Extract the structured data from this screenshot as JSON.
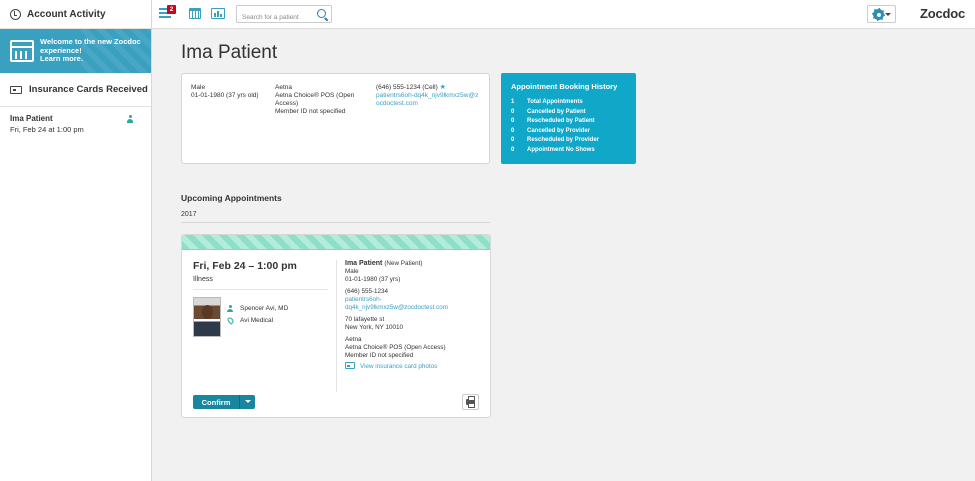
{
  "sidebar": {
    "header_title": "Account Activity",
    "welcome": {
      "line1": "Welcome to the new Zocdoc",
      "line2": "experience!",
      "line3": "Learn more."
    },
    "section_title": "Insurance Cards Received",
    "items": [
      {
        "name": "Ima Patient",
        "time": "Fri, Feb 24 at 1:00 pm"
      }
    ]
  },
  "topbar": {
    "badge_count": "2",
    "search_placeholder": "Search for a patient",
    "logo": "Zocdoc"
  },
  "main": {
    "page_title": "Ima Patient",
    "patient_info": {
      "gender": "Male",
      "dob": "01-01-1980 (37 yrs old)",
      "insurer": "Aetna",
      "plan": "Aetna Choice® POS (Open Access)",
      "member_id": "Member ID not specified",
      "phone": "(646) 555-1234 (Cell)",
      "email": "patientrs6oh-dq4k_njv9lkmxz5w@zocdoctest.com"
    },
    "history": {
      "title": "Appointment Booking History",
      "rows": [
        {
          "n": "1",
          "label": "Total Appointments"
        },
        {
          "n": "0",
          "label": "Cancelled by Patient"
        },
        {
          "n": "0",
          "label": "Rescheduled by Patient"
        },
        {
          "n": "0",
          "label": "Cancelled by Provider"
        },
        {
          "n": "0",
          "label": "Rescheduled by Provider"
        },
        {
          "n": "0",
          "label": "Appointment No Shows"
        }
      ]
    },
    "upcoming_title": "Upcoming Appointments",
    "year": "2017",
    "appointment": {
      "datetime": "Fri, Feb 24 – 1:00 pm",
      "reason": "Illness",
      "doctor": "Spencer Avi, MD",
      "practice": "Avi Medical",
      "patient_name": "Ima Patient",
      "patient_status": "(New Patient)",
      "gender": "Male",
      "dob": "01-01-1980 (37 yrs)",
      "phone": "(646) 555-1234",
      "email_line1": "patientrs6oh-",
      "email_line2": "dq4k_njv9lkmxz5w@zocdoctest.com",
      "address1": "70 lafayette st",
      "address2": "New York, NY 10010",
      "insurer": "Aetna",
      "plan": "Aetna Choice® POS (Open Access)",
      "member_id": "Member ID not specified",
      "view_photos": "View insurance card photos",
      "confirm_label": "Confirm"
    }
  },
  "colors": {
    "accent": "#3aa0c0",
    "history_bg": "#10a7c9",
    "confirm_bg": "#17869e",
    "badge": "#d0021b",
    "stripe": "#8ddfc7"
  }
}
